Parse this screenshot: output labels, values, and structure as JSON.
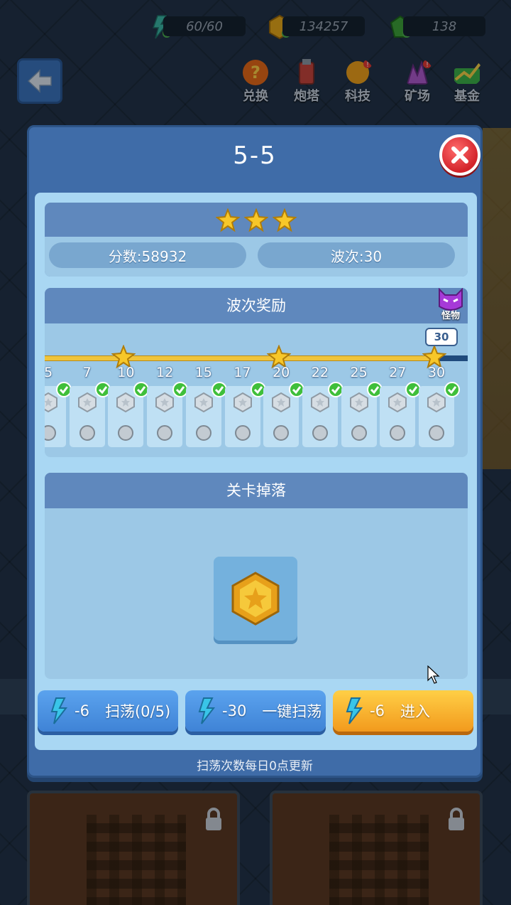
{
  "resources": {
    "energy": "60/60",
    "coins": "134257",
    "gems": "138"
  },
  "top_menu": [
    {
      "label": "兑换",
      "icon": "question-coin-icon",
      "color": "#e86a1a"
    },
    {
      "label": "炮塔",
      "icon": "turret-icon",
      "color": "#c8463e"
    },
    {
      "label": "科技",
      "icon": "tech-bulb-icon",
      "color": "#f0a21c"
    },
    {
      "label": "矿场",
      "icon": "crystal-mine-icon",
      "color": "#b05bd0"
    },
    {
      "label": "基金",
      "icon": "fund-chart-icon",
      "color": "#3db24a"
    }
  ],
  "modal": {
    "title": "5-5",
    "stars": 3,
    "score_label": "分数:58932",
    "wave_label": "波次:30",
    "wave_reward_title": "波次奖励",
    "monster_label": "怪物",
    "current_wave": "30",
    "waves": [
      "5",
      "7",
      "10",
      "12",
      "15",
      "17",
      "20",
      "22",
      "25",
      "27",
      "30"
    ],
    "drops_title": "关卡掉落",
    "drop_item": "gold-coin-icon",
    "footer_note": "扫荡次数每日0点更新"
  },
  "buttons": {
    "sweep": {
      "cost": "-6",
      "label": "扫荡(0/5)"
    },
    "sweep_all": {
      "cost": "-30",
      "label": "一键扫荡"
    },
    "enter": {
      "cost": "-6",
      "label": "进入"
    }
  },
  "colors": {
    "accent_blue": "#3f83d6",
    "accent_orange": "#f29a1d",
    "panel_blue": "#5f88bd",
    "close_red": "#d3232a"
  }
}
